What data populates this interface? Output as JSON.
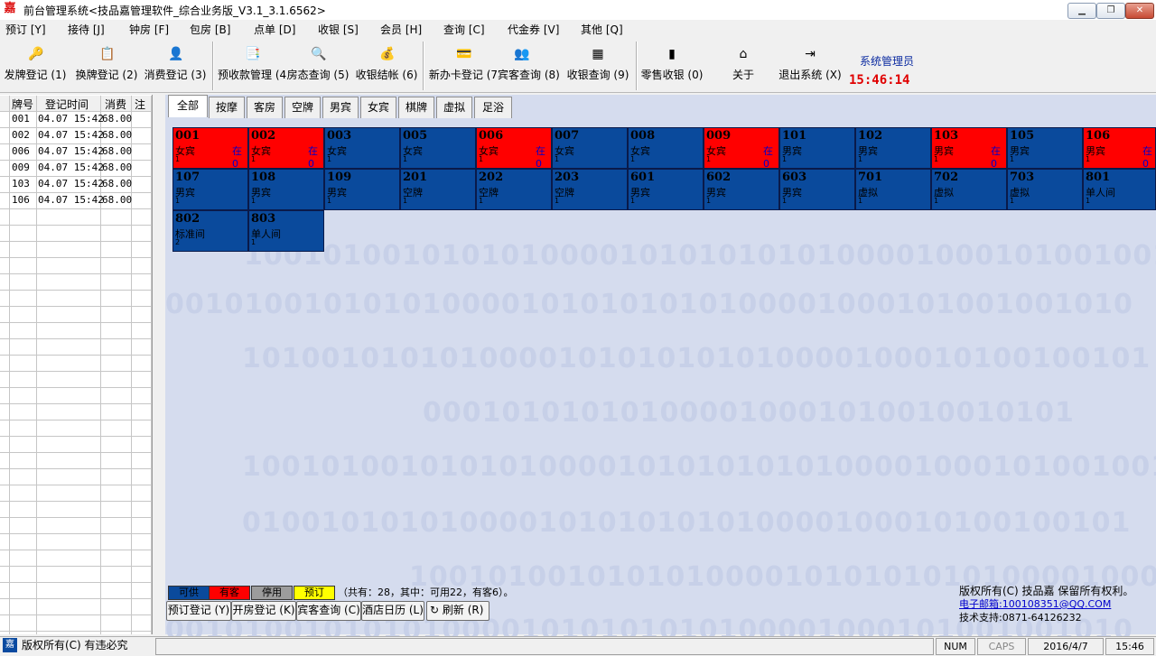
{
  "window": {
    "title": "前台管理系统<技品嘉管理软件_综合业务版_V3.1_3.1.6562>",
    "app_icon": "嘉",
    "minimize": "▁",
    "restore": "❐",
    "close": "✕"
  },
  "menu": [
    "预订 [Y]",
    "接待 [J]",
    "钟房 [F]",
    "包房 [B]",
    "点单 [D]",
    "收银 [S]",
    "会员 [H]",
    "查询 [C]",
    "代金券 [V]",
    "其他 [Q]"
  ],
  "toolbar": [
    {
      "label": "发牌登记 (1)",
      "icon": "🔑"
    },
    {
      "label": "换牌登记 (2)",
      "icon": "📋"
    },
    {
      "label": "消费登记 (3)",
      "icon": "👤"
    },
    {
      "label": "预收款管理 (4",
      "icon": "📑"
    },
    {
      "label": "房态查询 (5)",
      "icon": "🔍"
    },
    {
      "label": "收银结帐 (6)",
      "icon": "💰"
    },
    {
      "label": "新办卡登记 (7",
      "icon": "💳"
    },
    {
      "label": "宾客查询 (8)",
      "icon": "👥"
    },
    {
      "label": "收银查询 (9)",
      "icon": "▦"
    },
    {
      "label": "零售收银 (0)",
      "icon": "▮"
    },
    {
      "label": "关于",
      "icon": "⌂"
    },
    {
      "label": "退出系统 (X)",
      "icon": "⇥"
    }
  ],
  "user": {
    "name": "系统管理员",
    "clock": "15:46:14"
  },
  "list": {
    "headers": [
      "牌号",
      "登记时间",
      "消费",
      "注"
    ],
    "rows": [
      [
        "001",
        "04.07 15:42",
        "68.00"
      ],
      [
        "002",
        "04.07 15:42",
        "68.00"
      ],
      [
        "006",
        "04.07 15:42",
        "68.00"
      ],
      [
        "009",
        "04.07 15:42",
        "68.00"
      ],
      [
        "103",
        "04.07 15:42",
        "68.00"
      ],
      [
        "106",
        "04.07 15:42",
        "68.00"
      ]
    ]
  },
  "tabs": [
    "全部",
    "按摩",
    "客房",
    "空牌",
    "男宾",
    "女宾",
    "棋牌",
    "虚拟",
    "足浴"
  ],
  "rooms": [
    {
      "num": "001",
      "type": "女宾",
      "count": "1",
      "state": "在0",
      "status": "occupied"
    },
    {
      "num": "002",
      "type": "女宾",
      "count": "1",
      "state": "在0",
      "status": "occupied"
    },
    {
      "num": "003",
      "type": "女宾",
      "count": "1",
      "state": "",
      "status": "free"
    },
    {
      "num": "005",
      "type": "女宾",
      "count": "1",
      "state": "",
      "status": "free"
    },
    {
      "num": "006",
      "type": "女宾",
      "count": "1",
      "state": "在0",
      "status": "occupied"
    },
    {
      "num": "007",
      "type": "女宾",
      "count": "1",
      "state": "",
      "status": "free"
    },
    {
      "num": "008",
      "type": "女宾",
      "count": "1",
      "state": "",
      "status": "free"
    },
    {
      "num": "009",
      "type": "女宾",
      "count": "1",
      "state": "在0",
      "status": "occupied"
    },
    {
      "num": "101",
      "type": "男宾",
      "count": "1",
      "state": "",
      "status": "free"
    },
    {
      "num": "102",
      "type": "男宾",
      "count": "1",
      "state": "",
      "status": "free"
    },
    {
      "num": "103",
      "type": "男宾",
      "count": "1",
      "state": "在0",
      "status": "occupied"
    },
    {
      "num": "105",
      "type": "男宾",
      "count": "1",
      "state": "",
      "status": "free"
    },
    {
      "num": "106",
      "type": "男宾",
      "count": "1",
      "state": "在0",
      "status": "occupied"
    },
    {
      "num": "107",
      "type": "男宾",
      "count": "1",
      "state": "",
      "status": "free"
    },
    {
      "num": "108",
      "type": "男宾",
      "count": "1",
      "state": "",
      "status": "free"
    },
    {
      "num": "109",
      "type": "男宾",
      "count": "1",
      "state": "",
      "status": "free"
    },
    {
      "num": "201",
      "type": "空牌",
      "count": "1",
      "state": "",
      "status": "free"
    },
    {
      "num": "202",
      "type": "空牌",
      "count": "1",
      "state": "",
      "status": "free"
    },
    {
      "num": "203",
      "type": "空牌",
      "count": "1",
      "state": "",
      "status": "free"
    },
    {
      "num": "601",
      "type": "男宾",
      "count": "1",
      "state": "",
      "status": "free"
    },
    {
      "num": "602",
      "type": "男宾",
      "count": "1",
      "state": "",
      "status": "free"
    },
    {
      "num": "603",
      "type": "男宾",
      "count": "1",
      "state": "",
      "status": "free"
    },
    {
      "num": "701",
      "type": "虚拟",
      "count": "1",
      "state": "",
      "status": "free"
    },
    {
      "num": "702",
      "type": "虚拟",
      "count": "1",
      "state": "",
      "status": "free"
    },
    {
      "num": "703",
      "type": "虚拟",
      "count": "1",
      "state": "",
      "status": "free"
    },
    {
      "num": "801",
      "type": "单人间",
      "count": "1",
      "state": "",
      "status": "free"
    },
    {
      "num": "802",
      "type": "标准间",
      "count": "2",
      "state": "",
      "status": "free"
    },
    {
      "num": "803",
      "type": "单人间",
      "count": "1",
      "state": "",
      "status": "free"
    }
  ],
  "colors": {
    "free": "#0a4a9c",
    "occupied": "#ff0000",
    "disabled": "#9c9c9c",
    "reserved": "#ffff00"
  },
  "legend": [
    "可供",
    "有客",
    "停用",
    "预订"
  ],
  "summary": "（共有：28，其中：可用22，有客6）。",
  "watermark": [
    "10010100101010100001010101010100001000101001001010",
    "0010100101010100001010101010100001000101001001010",
    "1010010101010000101010101010000100010100100101",
    "000101010101000010001010010010101",
    "10010100101010100001010101010100001000101001001010",
    "010010101010000101010101010000100010100100101",
    "100101001010101000010101010101000010001",
    "0010100101010100001010101010100001000101001001010"
  ],
  "bottom_buttons": [
    "预订登记 (Y)",
    "开房登记 (K)",
    "宾客查询 (C)",
    "酒店日历 (L)",
    "刷新 (R)"
  ],
  "refresh_icon": "↻",
  "copyright": {
    "line1": "版权所有(C) 技品嘉 保留所有权利。",
    "email": "电子邮箱:100108351@QQ.COM",
    "support": "技术支持:0871-64126232"
  },
  "statusbar": {
    "logo": "嘉",
    "text": "版权所有(C) 有违必究",
    "num": "NUM",
    "caps": "CAPS",
    "date": "2016/4/7",
    "time": "15:46"
  }
}
